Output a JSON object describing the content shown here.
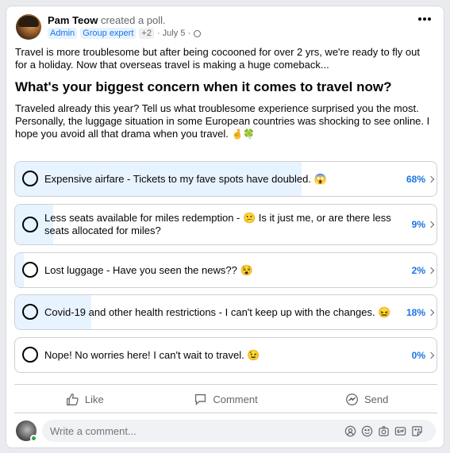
{
  "post": {
    "author": "Pam Teow",
    "action": "created a poll.",
    "badges": [
      "Admin",
      "Group expert"
    ],
    "badge_more": "+2",
    "date": "· July 5 ·",
    "intro": "Travel is more troublesome but after being cocooned for over 2 yrs, we're ready to fly out for a holiday. Now that overseas travel is making a huge comeback...",
    "question": "What's your biggest concern when it comes to travel now?",
    "description": "Traveled already this year? Tell us what troublesome experience surprised you the most. Personally, the luggage situation in some European countries was shocking to see online. I hope you avoid all that drama when you travel.",
    "description_emoji": "🤞🍀"
  },
  "poll": {
    "options": [
      {
        "text": "Expensive airfare - Tickets to my fave spots have doubled. 😱",
        "percent": "68%",
        "fill": 0.68
      },
      {
        "text": "Less seats available for miles redemption - 😕 Is it just me, or are there less seats allocated for miles?",
        "percent": "9%",
        "fill": 0.09
      },
      {
        "text": "Lost luggage - Have you seen the news?? 😵",
        "percent": "2%",
        "fill": 0.02
      },
      {
        "text": "Covid-19 and other health restrictions - I can't keep up with the changes. 😖",
        "percent": "18%",
        "fill": 0.18
      },
      {
        "text": "Nope! No worries here! I can't wait to travel. 😉",
        "percent": "0%",
        "fill": 0
      }
    ]
  },
  "actions": {
    "like": "Like",
    "comment": "Comment",
    "send": "Send"
  },
  "comment_input": {
    "placeholder": "Write a comment..."
  },
  "icons": {
    "more": "more-options-icon",
    "privacy": "globe-icon",
    "like": "thumbs-up-icon",
    "comment": "speech-bubble-icon",
    "send": "messenger-icon",
    "comment_tools": [
      "avatar-sticker-icon",
      "emoji-icon",
      "camera-icon",
      "gif-icon",
      "sticker-icon"
    ]
  },
  "colors": {
    "accent": "#1b74e4",
    "poll_fill": "#e7f3ff",
    "online": "#31a24c"
  }
}
